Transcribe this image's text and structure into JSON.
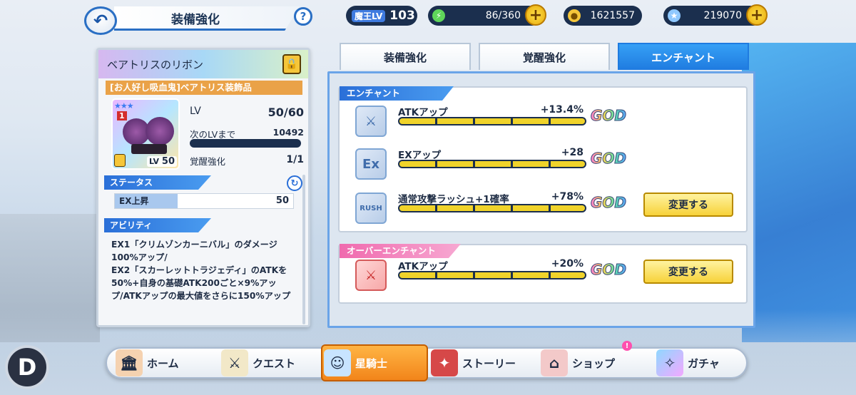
{
  "header": {
    "back_icon": "back-arrow-icon",
    "title": "装備強化",
    "help_label": "?"
  },
  "resources": {
    "level_label": "魔王LV",
    "level_value": "103",
    "stamina": "86/360",
    "coins": "1621557",
    "gems": "219070",
    "plus_label": "+"
  },
  "item": {
    "name": "ベアトリスのリボン",
    "type": "[お人好し吸血鬼]ベアトリス装飾品",
    "lv_label": "LV",
    "lv_value": "50/60",
    "thumb_lv_label": "LV",
    "thumb_lv_value": "50",
    "next_lv_label": "次のLVまで",
    "next_lv_value": "10492",
    "awaken_label": "覚醒強化",
    "awaken_value": "1/1",
    "badge": "1"
  },
  "status": {
    "header": "ステータス",
    "label": "EX上昇",
    "value": "50"
  },
  "ability": {
    "header": "アビリティ",
    "text": "EX1「クリムゾンカーニバル」のダメージ100%アップ/\nEX2「スカーレットトラジェディ」のATKを50%+自身の基礎ATK200ごと×9%アップ/ATKアップの最大値をさらに150%アップ"
  },
  "tabs": [
    {
      "label": "装備強化",
      "active": false
    },
    {
      "label": "覚醒強化",
      "active": false
    },
    {
      "label": "エンチャント",
      "active": true
    }
  ],
  "enchant": {
    "header": "エンチャント",
    "rows": [
      {
        "name": "ATKアップ",
        "value": "+13.4%",
        "rank": "GOD",
        "icon": "sword-icon",
        "button": null
      },
      {
        "name": "EXアップ",
        "value": "+28",
        "rank": "GOD",
        "icon": "ex-icon",
        "button": null
      },
      {
        "name": "通常攻撃ラッシュ+1確率",
        "value": "+78%",
        "rank": "GOD",
        "icon": "rush-icon",
        "button": "変更する"
      }
    ]
  },
  "over_enchant": {
    "header": "オーバーエンチャント",
    "rows": [
      {
        "name": "ATKアップ",
        "value": "+20%",
        "rank": "GOD",
        "icon": "sword-red-icon",
        "button": "変更する"
      }
    ]
  },
  "nav": {
    "d_label": "D",
    "items": [
      {
        "label": "ホーム",
        "icon": "home-icon"
      },
      {
        "label": "クエスト",
        "icon": "quest-sword-icon"
      },
      {
        "label": "星騎士",
        "icon": "knight-icon",
        "active": true
      },
      {
        "label": "ストーリー",
        "icon": "book-icon"
      },
      {
        "label": "ショップ",
        "icon": "shop-icon"
      },
      {
        "label": "ガチャ",
        "icon": "gacha-card-icon"
      }
    ],
    "notif": "!"
  },
  "colors": {
    "accent_blue": "#1f7be0",
    "over_enchant_pink": "#f47ab8",
    "button_yellow": "#f7d23a",
    "panel_dark": "#1b2f4e"
  }
}
